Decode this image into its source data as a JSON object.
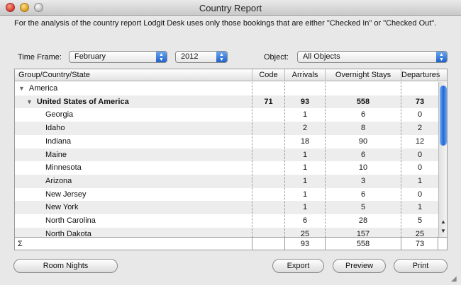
{
  "window": {
    "title": "Country Report"
  },
  "intro": "For the analysis of the country report Lodgit Desk uses only those bookings that are either \"Checked In\" or \"Checked Out\".",
  "filters": {
    "timeframe_label": "Time Frame:",
    "month": "February",
    "year": "2012",
    "object_label": "Object:",
    "object": "All Objects"
  },
  "table": {
    "columns": [
      "Group/Country/State",
      "Code",
      "Arrivals",
      "Overnight Stays",
      "Departures"
    ],
    "group": {
      "name": "America"
    },
    "country": {
      "name": "United States of America",
      "code": "71",
      "arrivals": "93",
      "stays": "558",
      "departures": "73"
    },
    "rows": [
      {
        "name": "Georgia",
        "arrivals": "1",
        "stays": "6",
        "departures": "0"
      },
      {
        "name": "Idaho",
        "arrivals": "2",
        "stays": "8",
        "departures": "2"
      },
      {
        "name": "Indiana",
        "arrivals": "18",
        "stays": "90",
        "departures": "12"
      },
      {
        "name": "Maine",
        "arrivals": "1",
        "stays": "6",
        "departures": "0"
      },
      {
        "name": "Minnesota",
        "arrivals": "1",
        "stays": "10",
        "departures": "0"
      },
      {
        "name": "Arizona",
        "arrivals": "1",
        "stays": "3",
        "departures": "1"
      },
      {
        "name": "New Jersey",
        "arrivals": "1",
        "stays": "6",
        "departures": "0"
      },
      {
        "name": "New York",
        "arrivals": "1",
        "stays": "5",
        "departures": "1"
      },
      {
        "name": "North Carolina",
        "arrivals": "6",
        "stays": "28",
        "departures": "5"
      },
      {
        "name": "North Dakota",
        "arrivals": "25",
        "stays": "157",
        "departures": "25"
      }
    ],
    "sum": {
      "symbol": "Σ",
      "arrivals": "93",
      "stays": "558",
      "departures": "73"
    }
  },
  "buttons": {
    "room_nights": "Room Nights",
    "export": "Export",
    "preview": "Preview",
    "print": "Print"
  },
  "icons": {
    "close": "close-icon",
    "minimize": "minimize-icon",
    "zoom": "zoom-icon",
    "expand": "disclosure-triangle-icon",
    "scroll_up": "scroll-up-arrow-icon",
    "scroll_down": "scroll-down-arrow-icon"
  },
  "colors": {
    "accent": "#2168d8"
  }
}
